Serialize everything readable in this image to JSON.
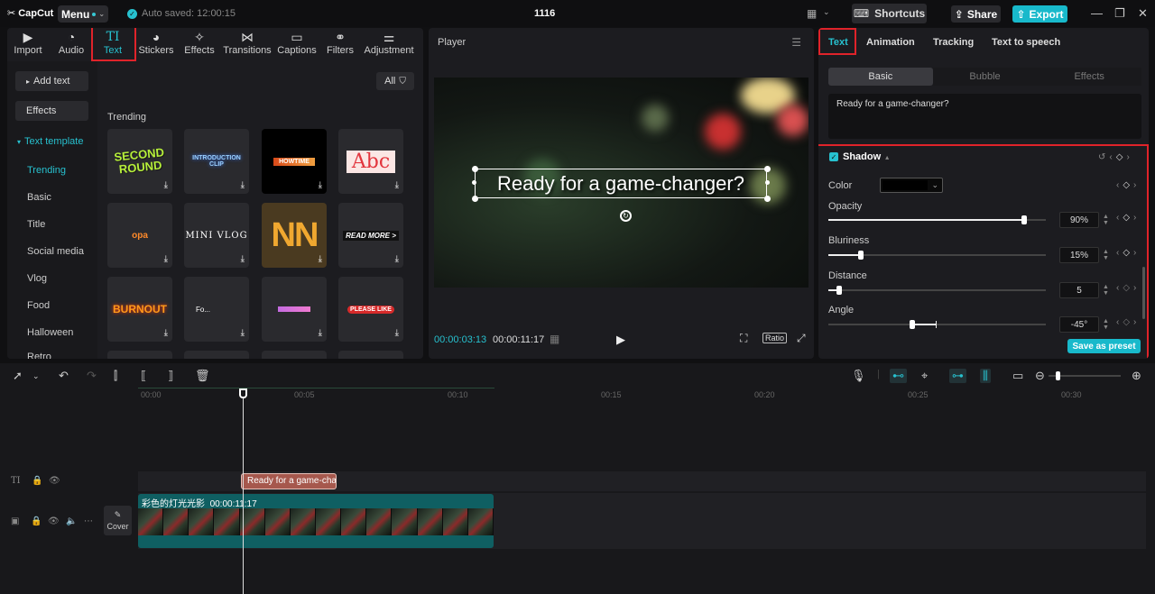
{
  "app": {
    "logo": "CapCut",
    "menu_label": "Menu",
    "autosave": "Auto saved: 12:00:15",
    "project_title": "1116",
    "shortcuts": "Shortcuts",
    "share": "Share",
    "export": "Export",
    "accent": "#27c1cf",
    "highlight_color": "#e0232a"
  },
  "tool_tabs": [
    {
      "label": "Import",
      "icon": "import-icon"
    },
    {
      "label": "Audio",
      "icon": "audio-icon"
    },
    {
      "label": "Text",
      "icon": "text-icon",
      "active": true
    },
    {
      "label": "Stickers",
      "icon": "stickers-icon"
    },
    {
      "label": "Effects",
      "icon": "effects-icon"
    },
    {
      "label": "Transitions",
      "icon": "transitions-icon"
    },
    {
      "label": "Captions",
      "icon": "captions-icon"
    },
    {
      "label": "Filters",
      "icon": "filters-icon"
    },
    {
      "label": "Adjustment",
      "icon": "adjustment-icon"
    }
  ],
  "left_nav": {
    "add_text": "Add text",
    "effects": "Effects",
    "text_template": "Text template",
    "items": [
      "Trending",
      "Basic",
      "Title",
      "Social media",
      "Vlog",
      "Food",
      "Halloween",
      "Retro"
    ]
  },
  "library": {
    "filter_label": "All",
    "section": "Trending",
    "cards": [
      {
        "text": "SECOND ROUND"
      },
      {
        "text": "INTRODUCTION CLIP"
      },
      {
        "text": "HOWTIME"
      },
      {
        "text": "Abc"
      },
      {
        "text": "opa"
      },
      {
        "text": "MINI VLOG"
      },
      {
        "text": "NN"
      },
      {
        "text": "READ MORE >"
      },
      {
        "text": "BURNOUT"
      },
      {
        "text": "Fo..."
      },
      {
        "text": ""
      },
      {
        "text": "PLEASE LIKE"
      }
    ]
  },
  "player": {
    "title": "Player",
    "overlay_text": "Ready for a game-changer?",
    "current_time": "00:00:03:13",
    "total_time": "00:00:11:17",
    "ratio_label": "Ratio"
  },
  "right_panel": {
    "tabs": [
      "Text",
      "Animation",
      "Tracking",
      "Text to speech"
    ],
    "subtabs": [
      "Basic",
      "Bubble",
      "Effects"
    ],
    "text_value": "Ready for a game-changer?",
    "shadow": {
      "title": "Shadow",
      "color_label": "Color",
      "color_value": "#000000",
      "opacity_label": "Opacity",
      "opacity_value": "90%",
      "opacity_level": 0.9,
      "bluriness_label": "Bluriness",
      "bluriness_value": "15%",
      "bluriness_level": 0.15,
      "distance_label": "Distance",
      "distance_value": "5",
      "distance_level": 0.05,
      "angle_label": "Angle",
      "angle_value": "-45°"
    },
    "save_preset": "Save as preset"
  },
  "timeline": {
    "ticks": [
      "00:00",
      "00:05",
      "00:10",
      "00:15",
      "00:20",
      "00:25",
      "00:30"
    ],
    "text_clip": "Ready for a game-changer?",
    "video_clip_name": "彩色的灯光光影",
    "video_clip_duration": "00:00:11:17",
    "cover_label": "Cover"
  }
}
